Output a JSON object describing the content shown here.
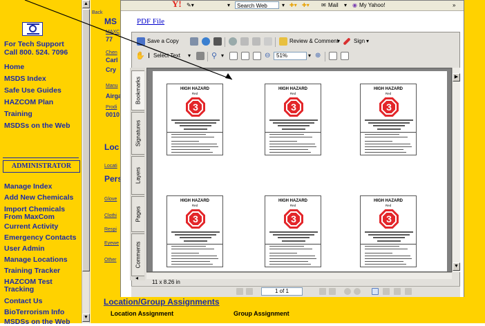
{
  "left_nav": {
    "tech_support_line1": "For Tech Support",
    "tech_support_line2": "Call 800. 524. 7096",
    "items": [
      {
        "label": "Home"
      },
      {
        "label": "MSDS Index"
      },
      {
        "label": "Safe Use Guides"
      },
      {
        "label": "HAZCOM Plan"
      },
      {
        "label": "Training"
      },
      {
        "label": "MSDSs on the Web"
      }
    ],
    "admin_header": "ADMINISTRATOR",
    "admin_items": [
      {
        "label": "Manage Index"
      },
      {
        "label": "Add New Chemicals"
      },
      {
        "label": "Import Chemicals"
      },
      {
        "label": "From MaxCom"
      },
      {
        "label": "Current Activity"
      },
      {
        "label": "Emergency Contacts"
      },
      {
        "label": "User Admin"
      },
      {
        "label": "Manage Locations"
      },
      {
        "label": "Training Tracker"
      },
      {
        "label": "HAZCOM Test"
      },
      {
        "label": "Tracking"
      },
      {
        "label": "Contact Us"
      },
      {
        "label": "BioTerrorism Info"
      },
      {
        "label": "MSDSs on the Web"
      }
    ]
  },
  "main_page": {
    "back": "Back",
    "ms": "MS",
    "maxc": "MAXC",
    "num_fragment": "77",
    "chem": "Chen",
    "cal": "Carl",
    "cry": "Cry",
    "manu": "Manu",
    "airg": "Airga",
    "prod": "Prodi",
    "code": "0010",
    "loc": "Loc",
    "locati": "Locati",
    "pers": "Pers",
    "glove": "Glove",
    "cloth": "Clothi",
    "resp": "Respi",
    "eyew": "Eyewe",
    "other": "Other",
    "bottom_heading": "Location/Group Assignments",
    "col_location": "Location Assignment",
    "col_group": "Group Assignment"
  },
  "browser_bar": {
    "yahoo_logo": "Y!",
    "search_button": "Search Web",
    "mail": "Mail",
    "my_yahoo": "My Yahoo!",
    "overflow": "»"
  },
  "pdf": {
    "link_text": "PDF File",
    "save_copy": "Save a Copy",
    "select_text": "Select Text",
    "zoom_value": "51%",
    "review_comment": "Review & Comment",
    "sign": "Sign",
    "page_field": "1 of 1",
    "page_size": "11 x 8.26 in",
    "side_tabs": [
      "Bookmarks",
      "Signatures",
      "Layers",
      "Pages",
      "Comments"
    ]
  },
  "labels": {
    "title": "HIGH HAZARD",
    "subtitle": "Red",
    "rating": "3",
    "count": 6
  },
  "colors": {
    "nav_bg": "#ffd200",
    "nav_text": "#1a2aa8",
    "hazard_red": "#e3262a",
    "yahoo_red": "#e2231a"
  }
}
